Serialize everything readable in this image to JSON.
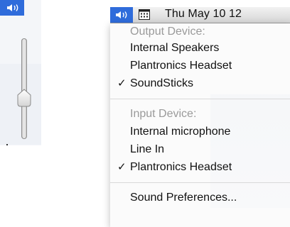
{
  "volume_popup": {
    "icon": "speaker-volume-icon",
    "accent": "#2f6cdb",
    "level": 0.4
  },
  "menubar": {
    "speaker_icon": "speaker-volume-icon",
    "calendar_icon": "calendar-icon",
    "clock": "Thu May 10  12"
  },
  "menu": {
    "output_header": "Output Device:",
    "output_devices": [
      {
        "label": "Internal Speakers",
        "checked": false
      },
      {
        "label": "Plantronics Headset",
        "checked": false
      },
      {
        "label": "SoundSticks",
        "checked": true
      }
    ],
    "input_header": "Input Device:",
    "input_devices": [
      {
        "label": "Internal microphone",
        "checked": false
      },
      {
        "label": "Line In",
        "checked": false
      },
      {
        "label": "Plantronics Headset",
        "checked": true
      }
    ],
    "preferences": "Sound Preferences...",
    "check_glyph": "✓"
  }
}
